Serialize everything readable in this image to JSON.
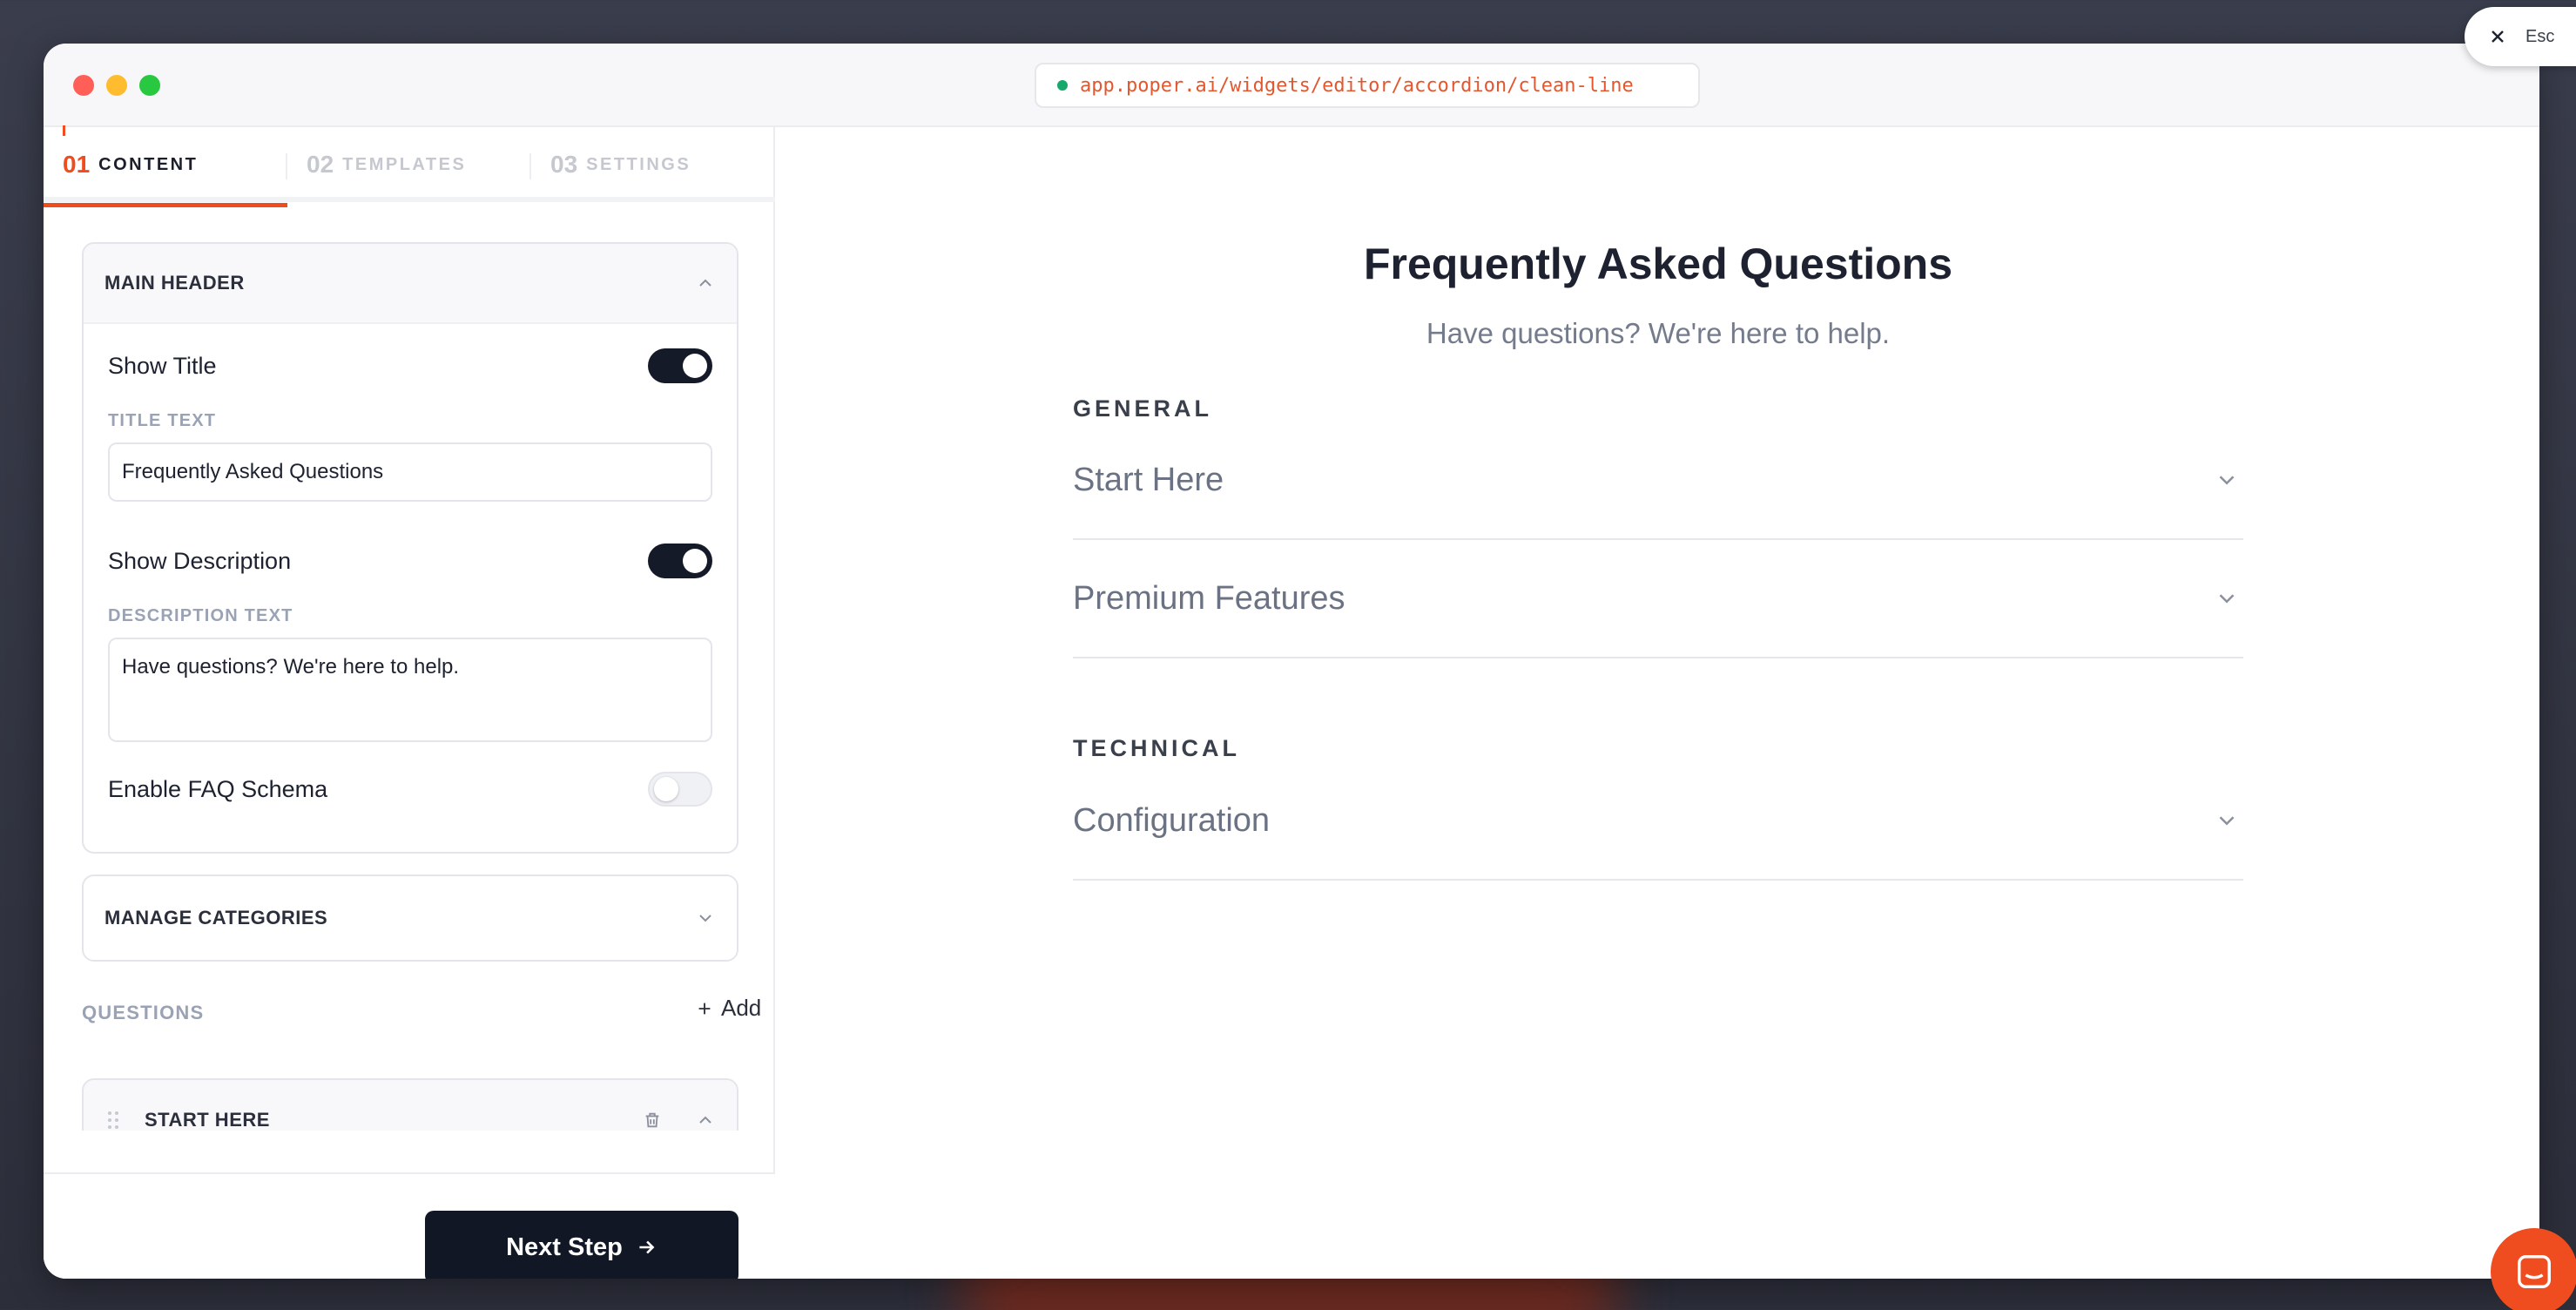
{
  "browser": {
    "url": "app.poper.ai/widgets/editor/accordion/clean-line",
    "dots": [
      "#ff5f57",
      "#febc2e",
      "#28c840"
    ]
  },
  "tabs": [
    {
      "num": "01",
      "label": "CONTENT",
      "active": true
    },
    {
      "num": "02",
      "label": "TEMPLATES",
      "active": false
    },
    {
      "num": "03",
      "label": "SETTINGS",
      "active": false
    }
  ],
  "main_header": {
    "title": "MAIN HEADER",
    "show_title_label": "Show Title",
    "show_title": true,
    "title_text_label": "TITLE TEXT",
    "title_text_value": "Frequently Asked Questions",
    "show_description_label": "Show Description",
    "show_description": true,
    "description_text_label": "DESCRIPTION TEXT",
    "description_text_value": "Have questions? We're here to help.",
    "faq_schema_label": "Enable FAQ Schema",
    "faq_schema": false
  },
  "manage_categories": {
    "title": "MANAGE CATEGORIES"
  },
  "questions": {
    "label": "QUESTIONS",
    "add_label": "Add",
    "first_item": "START HERE"
  },
  "footer": {
    "next_label": "Next Step"
  },
  "preview": {
    "title": "Frequently Asked Questions",
    "subtitle": "Have questions? We're here to help.",
    "categories": [
      {
        "name": "GENERAL",
        "items": [
          "Start Here",
          "Premium Features"
        ]
      },
      {
        "name": "TECHNICAL",
        "items": [
          "Configuration"
        ]
      }
    ]
  },
  "close": {
    "hint": "Esc"
  },
  "colors": {
    "accent": "#ef4d1f",
    "dark": "#121726"
  }
}
